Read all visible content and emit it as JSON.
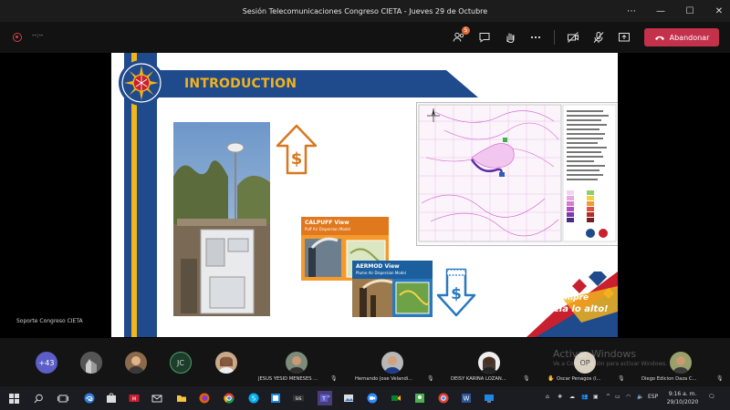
{
  "window": {
    "title": "Sesión Telecomunicaciones Congreso CIETA - Jueves 29 de Octubre"
  },
  "toolbar": {
    "timer": "--:--",
    "participants_badge": "5",
    "leave_label": "Abandonar",
    "leave_color": "#c4314b"
  },
  "slide": {
    "heading": "INTRODUCTION",
    "heading_color": "#f2b21d",
    "banner_color": "#1f4a8c",
    "thumb1_title": "CALPUFF View",
    "thumb1_sub": "Puff Air Dispersion Model",
    "thumb2_title": "AERMOD View",
    "thumb2_sub": "Plume Air Dispersion Model",
    "slogan_line1": "¡Siempre",
    "slogan_line2": "hacia lo alto!"
  },
  "caption": "Soporte Congreso CIETA",
  "gallery": {
    "overflow_count": "+43",
    "jc_initials": "JC",
    "op_initials": "OP",
    "names": [
      "JESUS YESID MENESES ...",
      "Hernando Jose Velandi...",
      "DEISY KARINA LOZAN...",
      "Oscar Penagos (I...",
      "Diego Edicion Daza C..."
    ],
    "watermark_title": "Activar Windows",
    "watermark_sub": "Ve a Configuración para activar Windows."
  },
  "taskbar": {
    "lang": "ESP",
    "time": "9:16 a. m.",
    "date": "29/10/2020"
  }
}
